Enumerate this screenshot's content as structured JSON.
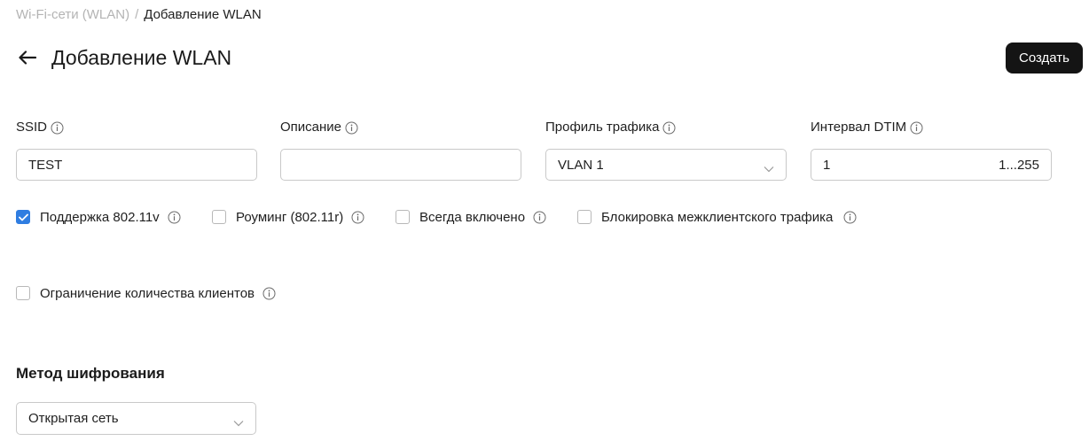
{
  "breadcrumb": {
    "parent": "Wi-Fi-сети (WLAN)",
    "separator": "/",
    "current": "Добавление WLAN"
  },
  "header": {
    "title": "Добавление WLAN",
    "back_icon": "arrow-left-icon",
    "create_label": "Создать"
  },
  "fields": {
    "ssid": {
      "label": "SSID",
      "value": "TEST"
    },
    "description": {
      "label": "Описание",
      "value": ""
    },
    "traffic_profile": {
      "label": "Профиль трафика",
      "selected": "VLAN 1"
    },
    "dtim": {
      "label": "Интервал DTIM",
      "value": "1",
      "range": "1...255"
    }
  },
  "checkboxes": [
    {
      "label": "Поддержка 802.11v",
      "checked": true
    },
    {
      "label": "Роуминг (802.11r)",
      "checked": false
    },
    {
      "label": "Всегда включено",
      "checked": false
    },
    {
      "label": "Блокировка межклиентского трафика",
      "checked": false
    },
    {
      "label": "Ограничение количества клиентов",
      "checked": false
    }
  ],
  "encryption": {
    "title": "Метод шифрования",
    "selected": "Открытая сеть"
  },
  "colors": {
    "accent": "#2f7de1",
    "primary_button": "#141414",
    "muted_text": "#b4b4b4",
    "border": "#c9c9c9"
  },
  "icons": {
    "info": "info-circle-icon",
    "chevron": "chevron-down-icon",
    "check": "checkmark-icon"
  }
}
